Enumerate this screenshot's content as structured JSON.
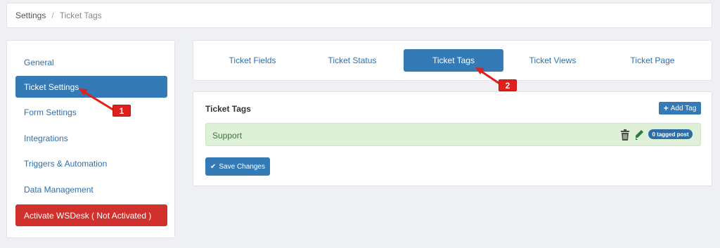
{
  "breadcrumb": {
    "root": "Settings",
    "separator": "/",
    "current": "Ticket Tags"
  },
  "sidebar": {
    "items": [
      {
        "label": "General"
      },
      {
        "label": "Ticket Settings"
      },
      {
        "label": "Form Settings"
      },
      {
        "label": "Integrations"
      },
      {
        "label": "Triggers & Automation"
      },
      {
        "label": "Data Management"
      },
      {
        "label": "Activate WSDesk ( Not Activated )"
      }
    ],
    "active_item": "Ticket Settings"
  },
  "tabs": {
    "items": [
      {
        "label": "Ticket Fields"
      },
      {
        "label": "Ticket Status"
      },
      {
        "label": "Ticket Tags"
      },
      {
        "label": "Ticket Views"
      },
      {
        "label": "Ticket Page"
      }
    ],
    "active_tab": "Ticket Tags"
  },
  "tags_panel": {
    "title": "Ticket Tags",
    "add_button_label": "Add Tag",
    "tags": [
      {
        "name": "Support",
        "badge": "0 tagged post"
      }
    ],
    "save_button_label": "Save Changes"
  },
  "annotations": {
    "marker_1": "1",
    "marker_2": "2"
  },
  "icons": {
    "add": "plus-icon",
    "delete": "trash-icon",
    "edit": "pencil-icon",
    "save": "checkmark-icon"
  },
  "colors": {
    "primary": "#337ab7",
    "danger": "#d0312d",
    "success_bg": "#dff0d8",
    "annotation": "#e0201c"
  }
}
